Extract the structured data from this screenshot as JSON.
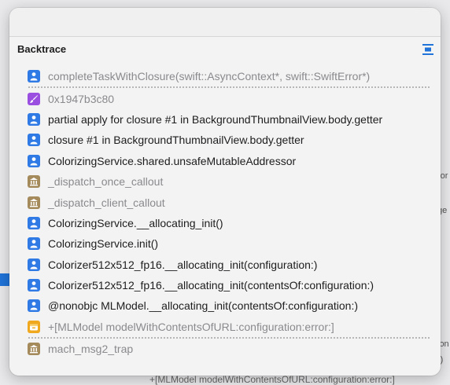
{
  "background": {
    "right_fragments": [
      "ror",
      "ge",
      "ion",
      "r)"
    ],
    "bottom_fragment": "+[MLModel modelWithContentsOfURL:configuration:error:]"
  },
  "panel": {
    "title": "Backtrace",
    "collapse_icon": "collapse-lines-icon"
  },
  "frames": [
    {
      "label": "completeTaskWithClosure(swift::AsyncContext*, swift::SwiftError*)",
      "icon": "user-icon",
      "dim": true
    },
    {
      "label": "0x1947b3c80",
      "icon": "brush-icon",
      "dim": true
    },
    {
      "label": "partial apply for closure #1 in BackgroundThumbnailView.body.getter",
      "icon": "user-icon",
      "dim": false
    },
    {
      "label": "closure #1 in BackgroundThumbnailView.body.getter",
      "icon": "user-icon",
      "dim": false
    },
    {
      "label": "ColorizingService.shared.unsafeMutableAddressor",
      "icon": "user-icon",
      "dim": false
    },
    {
      "label": "_dispatch_once_callout",
      "icon": "library-icon",
      "dim": true
    },
    {
      "label": "_dispatch_client_callout",
      "icon": "library-icon",
      "dim": true
    },
    {
      "label": "ColorizingService.__allocating_init()",
      "icon": "user-icon",
      "dim": false
    },
    {
      "label": "ColorizingService.init()",
      "icon": "user-icon",
      "dim": false
    },
    {
      "label": "Colorizer512x512_fp16.__allocating_init(configuration:)",
      "icon": "user-icon",
      "dim": false
    },
    {
      "label": "Colorizer512x512_fp16.__allocating_init(contentsOf:configuration:)",
      "icon": "user-icon",
      "dim": false
    },
    {
      "label": "@nonobjc MLModel.__allocating_init(contentsOf:configuration:)",
      "icon": "user-icon",
      "dim": false
    },
    {
      "label": "+[MLModel modelWithContentsOfURL:configuration:error:]",
      "icon": "objc-box-icon",
      "dim": true
    },
    {
      "label": "mach_msg2_trap",
      "icon": "library-icon",
      "dim": true
    }
  ],
  "colors": {
    "user": "#2f7ae5",
    "library": "#a58a5c",
    "brush": "#9b4fe0",
    "objc": "#f0a81f",
    "accent": "#1f73d9"
  }
}
